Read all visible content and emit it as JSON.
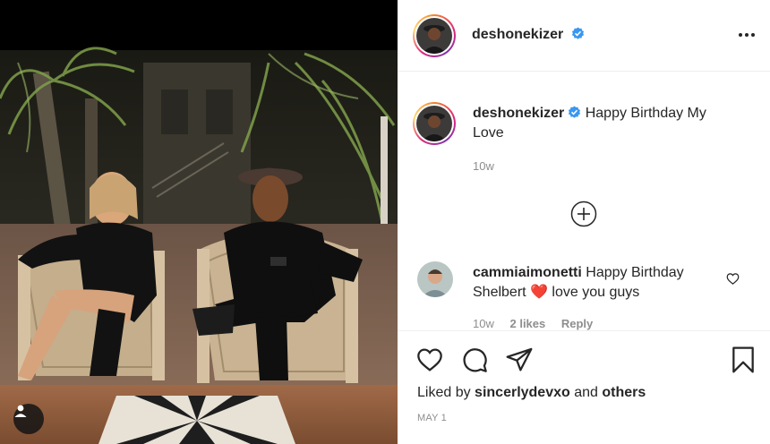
{
  "post": {
    "author": "deshonekizer",
    "verified": true,
    "menu_icon": "more-horizontal-icon"
  },
  "caption": {
    "author": "deshonekizer",
    "text": "Happy Birthday My Love",
    "time": "10w"
  },
  "comments": [
    {
      "author": "cammiaimonetti",
      "text_before": "Happy Birthday Shelbert",
      "emoji": "❤️",
      "text_after": "love you guys",
      "time": "10w",
      "likes": "2 likes",
      "reply": "Reply"
    }
  ],
  "actions": {
    "icons": [
      "heart-icon",
      "comment-icon",
      "share-icon",
      "bookmark-icon"
    ]
  },
  "likes": {
    "prefix": "Liked by",
    "user": "sincerlydevxo",
    "and": "and",
    "others": "others"
  },
  "date": "MAY 1",
  "colors": {
    "verified_blue": "#3897f0",
    "secondary_text": "#8e8e8e",
    "primary_text": "#262626",
    "emoji_red": "#e0245e"
  }
}
